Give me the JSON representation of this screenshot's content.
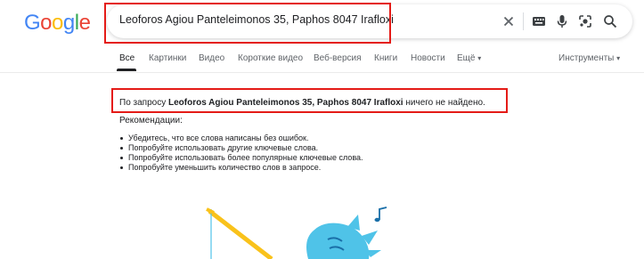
{
  "logo": {
    "letters": [
      "G",
      "o",
      "o",
      "g",
      "l",
      "e"
    ],
    "colors": [
      "#4285F4",
      "#EA4335",
      "#FBBC05",
      "#4285F4",
      "#34A853",
      "#EA4335"
    ]
  },
  "search": {
    "value": "Leoforos Agiou Panteleimonos 35, Paphos 8047 Irafloxi",
    "clear_icon": "close-icon",
    "icons": [
      "keyboard-icon",
      "mic-icon",
      "lens-icon",
      "search-icon"
    ]
  },
  "tabs": {
    "items": [
      "Все",
      "Картинки",
      "Видео",
      "Короткие видео",
      "Веб-версия",
      "Книги",
      "Новости",
      "Ещё"
    ],
    "more_caret": "▾",
    "tools": "Инструменты",
    "tools_caret": "▾"
  },
  "results": {
    "prefix": "По запросу ",
    "query": "Leoforos Agiou Panteleimonos 35, Paphos 8047 Irafloxi",
    "suffix": " ничего не найдено.",
    "recommendations_title": "Рекомендации:",
    "recommendations": [
      "Убедитесь, что все слова написаны без ошибок.",
      "Попробуйте использовать другие ключевые слова.",
      "Попробуйте использовать более популярные ключевые слова.",
      "Попробуйте уменьшить количество слов в запросе."
    ]
  },
  "colors": {
    "highlight": "#e41b17",
    "illustration_blue": "#4fc3e8",
    "illustration_yellow": "#f9c21b"
  }
}
